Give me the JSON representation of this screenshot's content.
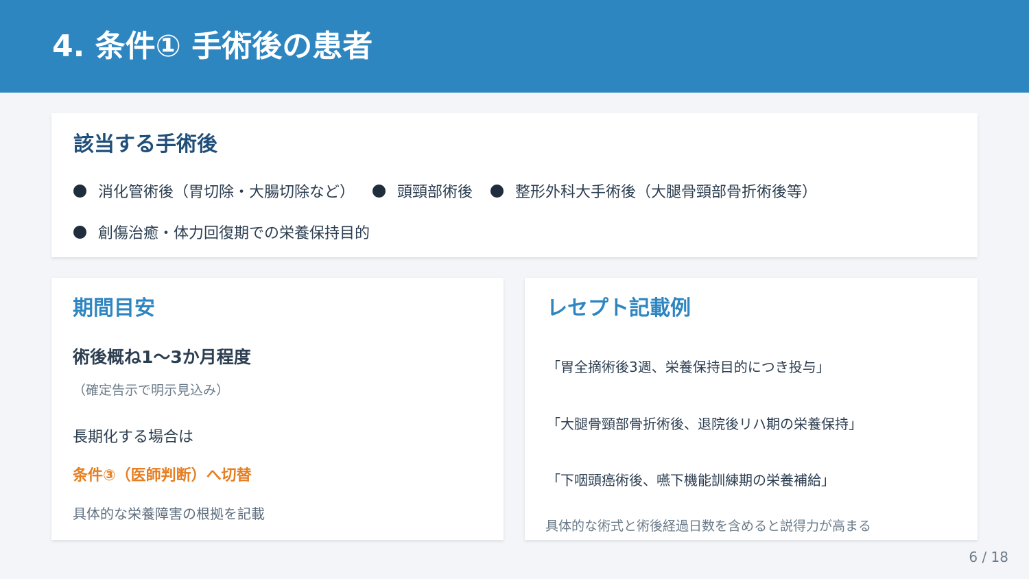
{
  "header": {
    "title": "4. 条件① 手術後の患者",
    "bg_color": "#2e86c1"
  },
  "applicable_card": {
    "title": "該当する手術後",
    "items": [
      "消化管術後（胃切除・大腸切除など）",
      "頭頸部術後",
      "整形外科大手術後（大腿骨頸部骨折術後等）",
      "創傷治癒・体力回復期での栄養保持目的"
    ]
  },
  "period_card": {
    "title": "期間目安",
    "duration": "術後概ね1～3か月程度",
    "duration_note": "（確定告示で明示見込み）",
    "long_term_label": "長期化する場合は",
    "switch_text": "条件③（医師判断）へ切替",
    "record_note": "具体的な栄養障害の根拠を記載",
    "accent_color": "#e67e22"
  },
  "receipt_card": {
    "title": "レセプト記載例",
    "examples": [
      "「胃全摘術後3週、栄養保持目的につき投与」",
      "「大腿骨頸部骨折術後、退院後リハ期の栄養保持」",
      "「下咽頭癌術後、嚥下機能訓練期の栄養補給」"
    ],
    "tip": "具体的な術式と術後経過日数を含めると説得力が高まる"
  },
  "footer": {
    "page_number": "6 / 18"
  }
}
